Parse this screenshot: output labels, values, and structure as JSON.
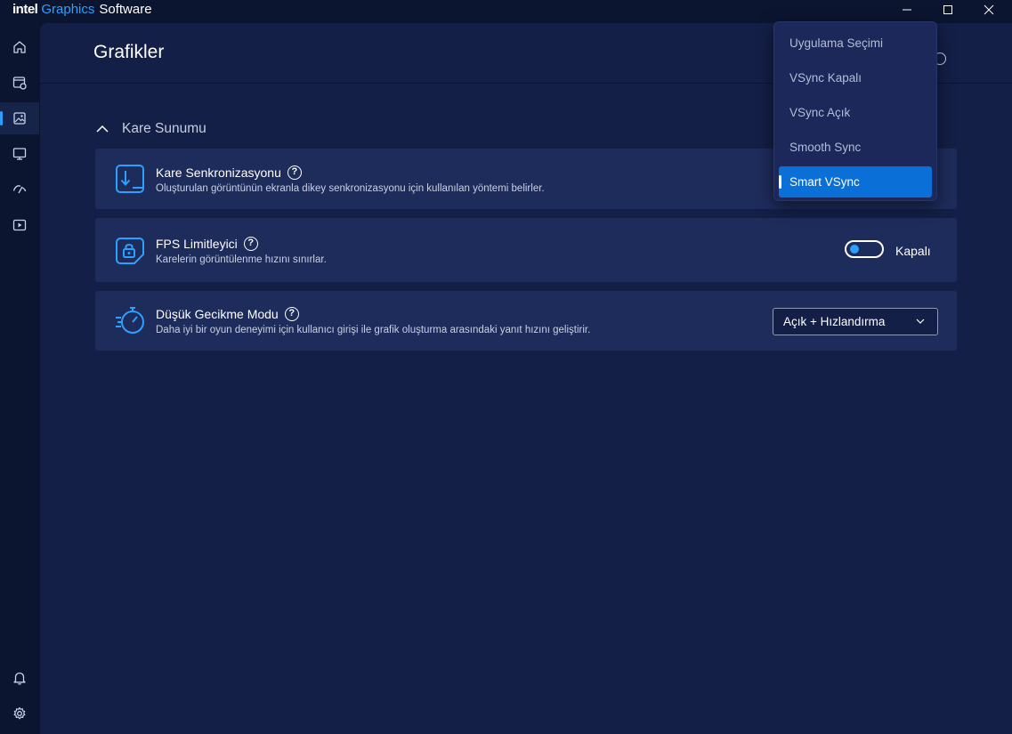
{
  "app": {
    "brand_intel": "intel",
    "brand_graphics": "Graphics",
    "brand_software": "Software"
  },
  "page": {
    "title": "Grafikler"
  },
  "section": {
    "title": "Kare Sunumu"
  },
  "cards": {
    "frame_sync": {
      "title": "Kare Senkronizasyonu",
      "description": "Oluşturulan görüntünün ekranla dikey senkronizasyonu için kullanılan yöntemi belirler."
    },
    "fps_limiter": {
      "title": "FPS Limitleyici",
      "description": "Karelerin görüntülenme hızını sınırlar.",
      "toggle_label": "Kapalı",
      "enabled": false
    },
    "low_latency": {
      "title": "Düşük Gecikme Modu",
      "description": "Daha iyi bir oyun deneyimi için kullanıcı girişi ile grafik oluşturma arasındaki yanıt hızını geliştirir.",
      "selected_value": "Açık + Hızlandırma"
    }
  },
  "dropdown": {
    "options": [
      "Uygulama Seçimi",
      "VSync Kapalı",
      "VSync Açık",
      "Smooth Sync",
      "Smart VSync"
    ],
    "selected_index": 4
  },
  "help_glyph": "?",
  "colors": {
    "accent": "#2aa0ff",
    "selected_item": "#0a6fd6",
    "card_bg": "#1e2c5c",
    "main_bg": "#141f47",
    "sidebar_bg": "#0c1530"
  }
}
